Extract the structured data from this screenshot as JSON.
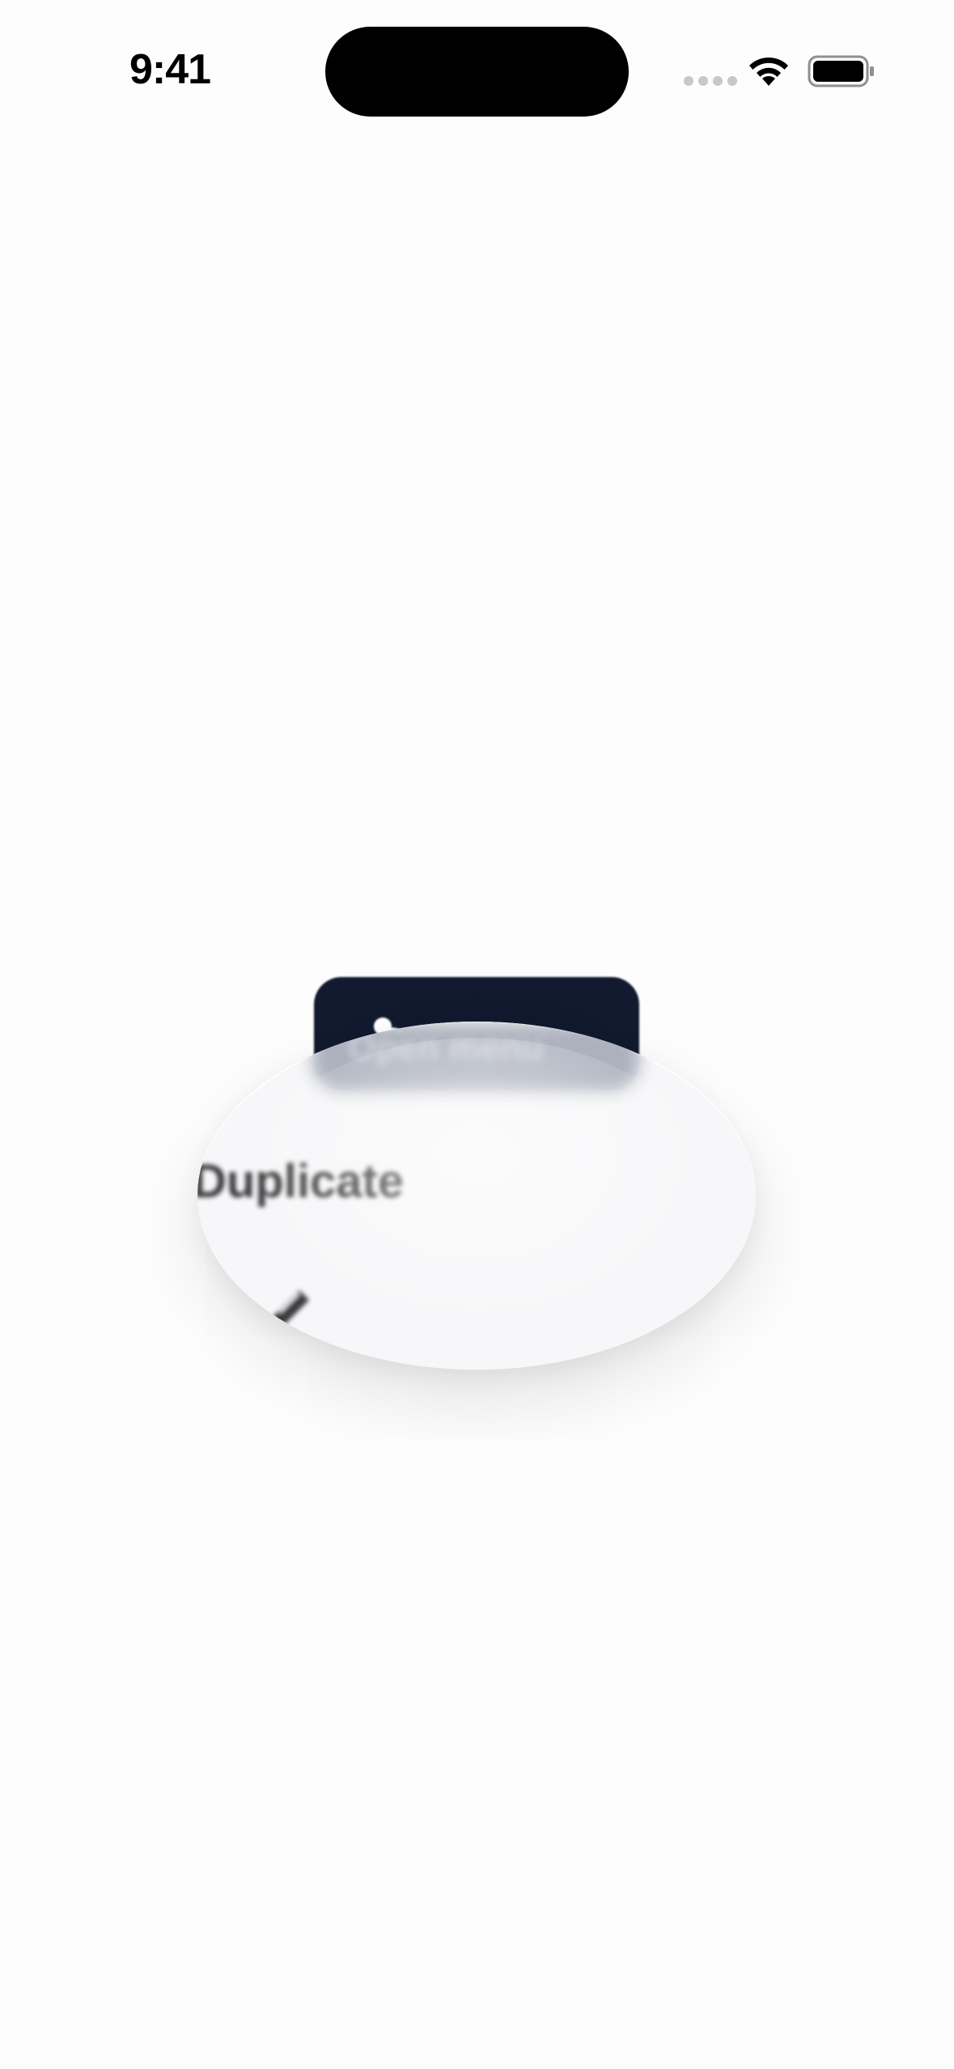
{
  "status_bar": {
    "time": "9:41"
  },
  "trigger": {
    "label": "Open menu"
  },
  "menu": {
    "items": [
      {
        "label": "Duplicate",
        "icon": "duplicate-icon"
      },
      {
        "label": "",
        "icon": "pencil-icon"
      }
    ]
  },
  "colors": {
    "background": "#fdfdfd",
    "trigger": "#111a2e",
    "menu_surface": "#f7f7f9",
    "text": "#3a3a3c"
  }
}
